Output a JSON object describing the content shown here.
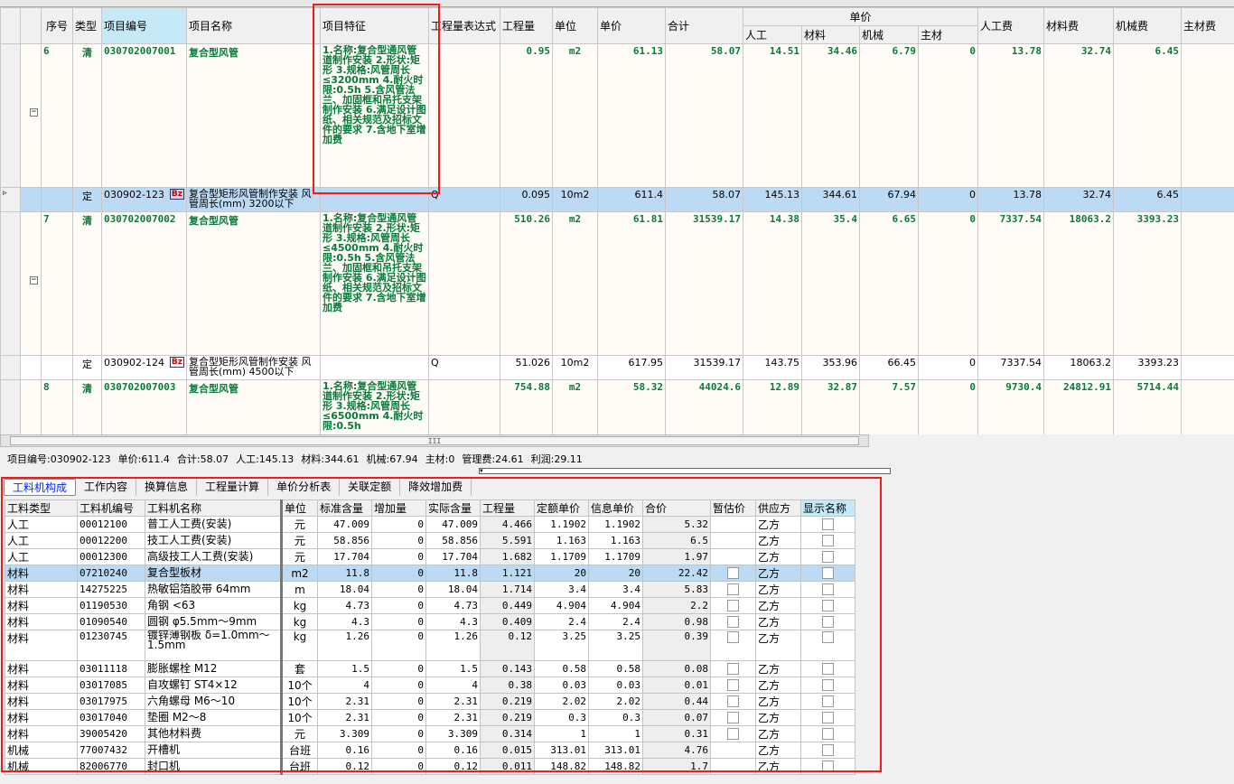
{
  "top_grid": {
    "headers": {
      "seq": "序号",
      "type": "类型",
      "code": "项目编号",
      "name": "项目名称",
      "feature": "项目特征",
      "expr": "工程量表达式",
      "qty": "工程量",
      "unit": "单位",
      "unit_price": "单价",
      "total": "合计",
      "unit_price_group": "单价",
      "labor": "人工",
      "material": "材料",
      "machine": "机械",
      "main_mat": "主材",
      "labor_fee": "人工费",
      "material_fee": "材料费",
      "machine_fee": "机械费",
      "main_mat_fee": "主材费"
    },
    "rows": [
      {
        "kind": "qd",
        "seq": "6",
        "type": "清",
        "code": "030702007001",
        "name": "复合型风管",
        "feature": "1.名称:复合型通风管道制作安装 2.形状:矩形 3.规格:风管周长≤3200mm 4.耐火时限:0.5h 5.含风管法兰、加固框和吊托支架制作安装 6.满足设计图纸、相关规范及招标文件的要求 7.含地下室增加费",
        "expr": "",
        "qty": "0.95",
        "unit": "m2",
        "unit_price": "61.13",
        "total": "58.07",
        "labor": "14.51",
        "material": "34.46",
        "machine": "6.79",
        "main_mat": "0",
        "labor_fee": "13.78",
        "material_fee": "32.74",
        "machine_fee": "6.45",
        "main_mat_fee": ""
      },
      {
        "kind": "de",
        "selected": true,
        "seq": "",
        "type": "定",
        "code": "030902-123",
        "name": "复合型矩形风管制作安装 风管周长(mm) 3200以下",
        "feature": "",
        "expr": "Q",
        "qty": "0.095",
        "unit": "10m2",
        "unit_price": "611.4",
        "total": "58.07",
        "labor": "145.13",
        "material": "344.61",
        "machine": "67.94",
        "main_mat": "0",
        "labor_fee": "13.78",
        "material_fee": "32.74",
        "machine_fee": "6.45",
        "main_mat_fee": ""
      },
      {
        "kind": "qd",
        "seq": "7",
        "type": "清",
        "code": "030702007002",
        "name": "复合型风管",
        "feature": "1.名称:复合型通风管道制作安装 2.形状:矩形 3.规格:风管周长≤4500mm 4.耐火时限:0.5h 5.含风管法兰、加固框和吊托支架制作安装 6.满足设计图纸、相关规范及招标文件的要求 7.含地下室增加费",
        "expr": "",
        "qty": "510.26",
        "unit": "m2",
        "unit_price": "61.81",
        "total": "31539.17",
        "labor": "14.38",
        "material": "35.4",
        "machine": "6.65",
        "main_mat": "0",
        "labor_fee": "7337.54",
        "material_fee": "18063.2",
        "machine_fee": "3393.23",
        "main_mat_fee": ""
      },
      {
        "kind": "de",
        "selected": false,
        "seq": "",
        "type": "定",
        "code": "030902-124",
        "name": "复合型矩形风管制作安装 风管周长(mm) 4500以下",
        "feature": "",
        "expr": "Q",
        "qty": "51.026",
        "unit": "10m2",
        "unit_price": "617.95",
        "total": "31539.17",
        "labor": "143.75",
        "material": "353.96",
        "machine": "66.45",
        "main_mat": "0",
        "labor_fee": "7337.54",
        "material_fee": "18063.2",
        "machine_fee": "3393.23",
        "main_mat_fee": ""
      },
      {
        "kind": "qd",
        "last": true,
        "seq": "8",
        "type": "清",
        "code": "030702007003",
        "name": "复合型风管",
        "feature": "1.名称:复合型通风管道制作安装 2.形状:矩形 3.规格:风管周长≤6500mm 4.耐火时限:0.5h",
        "expr": "",
        "qty": "754.88",
        "unit": "m2",
        "unit_price": "58.32",
        "total": "44024.6",
        "labor": "12.89",
        "material": "32.87",
        "machine": "7.57",
        "main_mat": "0",
        "labor_fee": "9730.4",
        "material_fee": "24812.91",
        "machine_fee": "5714.44",
        "main_mat_fee": ""
      }
    ]
  },
  "status_bar": [
    "项目编号:030902-123",
    "单价:611.4",
    "合计:58.07",
    "人工:145.13",
    "材料:344.61",
    "机械:67.94",
    "主材:0",
    "管理费:24.61",
    "利润:29.11"
  ],
  "tabs": [
    "工料机构成",
    "工作内容",
    "换算信息",
    "工程量计算",
    "单价分析表",
    "关联定额",
    "降效增加费"
  ],
  "lower_grid": {
    "headers": [
      "工料类型",
      "工料机编号",
      "工料机名称",
      "单位",
      "标准含量",
      "增加量",
      "实际含量",
      "工程量",
      "定额单价",
      "信息单价",
      "合价",
      "暂估价",
      "供应方",
      "显示名称"
    ],
    "rows": [
      [
        "人工",
        "00012100",
        "普工人工费(安装)",
        "元",
        "47.009",
        "0",
        "47.009",
        "4.466",
        "1.1902",
        "1.1902",
        "5.32",
        null,
        "乙方"
      ],
      [
        "人工",
        "00012200",
        "技工人工费(安装)",
        "元",
        "58.856",
        "0",
        "58.856",
        "5.591",
        "1.163",
        "1.163",
        "6.5",
        null,
        "乙方"
      ],
      [
        "人工",
        "00012300",
        "高级技工人工费(安装)",
        "元",
        "17.704",
        "0",
        "17.704",
        "1.682",
        "1.1709",
        "1.1709",
        "1.97",
        null,
        "乙方"
      ],
      [
        "材料",
        "07210240",
        "复合型板材",
        "m2",
        "11.8",
        "0",
        "11.8",
        "1.121",
        "20",
        "20",
        "22.42",
        false,
        "乙方"
      ],
      [
        "材料",
        "14275225",
        "热敏铝箔胶带 64mm",
        "m",
        "18.04",
        "0",
        "18.04",
        "1.714",
        "3.4",
        "3.4",
        "5.83",
        false,
        "乙方"
      ],
      [
        "材料",
        "01190530",
        "角钢 <63",
        "kg",
        "4.73",
        "0",
        "4.73",
        "0.449",
        "4.904",
        "4.904",
        "2.2",
        false,
        "乙方"
      ],
      [
        "材料",
        "01090540",
        "圆钢 φ5.5mm～9mm",
        "kg",
        "4.3",
        "0",
        "4.3",
        "0.409",
        "2.4",
        "2.4",
        "0.98",
        false,
        "乙方"
      ],
      [
        "材料",
        "01230745",
        "镀锌薄钢板 δ=1.0mm～1.5mm",
        "kg",
        "1.26",
        "0",
        "1.26",
        "0.12",
        "3.25",
        "3.25",
        "0.39",
        false,
        "乙方"
      ],
      [
        "材料",
        "03011118",
        "膨胀螺栓 M12",
        "套",
        "1.5",
        "0",
        "1.5",
        "0.143",
        "0.58",
        "0.58",
        "0.08",
        false,
        "乙方"
      ],
      [
        "材料",
        "03017085",
        "自攻螺钉 ST4×12",
        "10个",
        "4",
        "0",
        "4",
        "0.38",
        "0.03",
        "0.03",
        "0.01",
        false,
        "乙方"
      ],
      [
        "材料",
        "03017975",
        "六角螺母 M6～10",
        "10个",
        "2.31",
        "0",
        "2.31",
        "0.219",
        "2.02",
        "2.02",
        "0.44",
        false,
        "乙方"
      ],
      [
        "材料",
        "03017040",
        "垫圈 M2～8",
        "10个",
        "2.31",
        "0",
        "2.31",
        "0.219",
        "0.3",
        "0.3",
        "0.07",
        false,
        "乙方"
      ],
      [
        "材料",
        "39005420",
        "其他材料费",
        "元",
        "3.309",
        "0",
        "3.309",
        "0.314",
        "1",
        "1",
        "0.31",
        false,
        "乙方"
      ],
      [
        "机械",
        "77007432",
        "开槽机",
        "台班",
        "0.16",
        "0",
        "0.16",
        "0.015",
        "313.01",
        "313.01",
        "4.76",
        null,
        "乙方"
      ],
      [
        "机械",
        "82006770",
        "封口机",
        "台班",
        "0.12",
        "0",
        "0.12",
        "0.011",
        "148.82",
        "148.82",
        "1.7",
        null,
        "乙方"
      ]
    ]
  },
  "colors": {
    "highlight": "#f21b1b",
    "selected_row": "#bddaf5",
    "qd_text": "#0a7a3a",
    "active_tab": "#0026ff"
  }
}
